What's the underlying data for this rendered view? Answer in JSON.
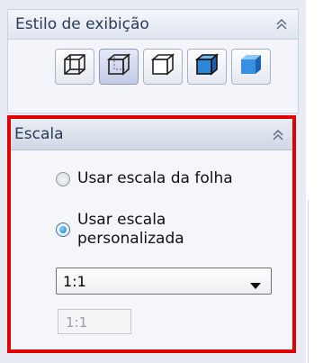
{
  "display_style": {
    "title": "Estilo de exibição",
    "buttons": [
      {
        "icon": "wireframe-icon",
        "selected": false
      },
      {
        "icon": "hidden-lines-visible-icon",
        "selected": true
      },
      {
        "icon": "hidden-lines-removed-icon",
        "selected": false
      },
      {
        "icon": "shaded-with-edges-icon",
        "selected": false
      },
      {
        "icon": "shaded-icon",
        "selected": false
      }
    ]
  },
  "scale": {
    "title": "Escala",
    "options": [
      {
        "label": "Usar escala da folha",
        "checked": false
      },
      {
        "label": "Usar escala personalizada",
        "checked": true
      }
    ],
    "dropdown_value": "1:1",
    "custom_field_value": "1:1"
  },
  "colors": {
    "highlight_border": "#e00000",
    "title_text": "#2b3a55"
  }
}
